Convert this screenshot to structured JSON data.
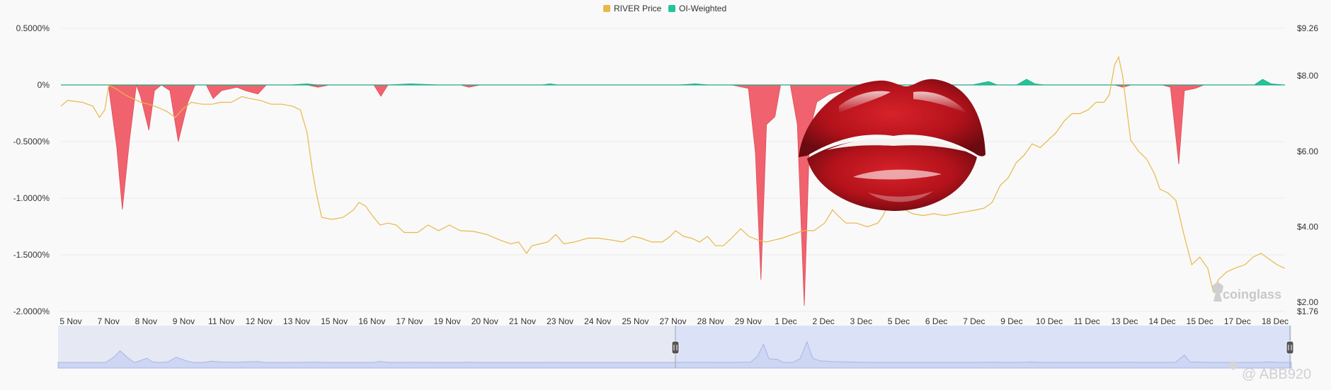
{
  "chart_data": {
    "type": "area",
    "legend": [
      {
        "name": "RIVER Price",
        "color": "#e8b84a"
      },
      {
        "name": "OI-Weighted",
        "color": "#22c59a"
      }
    ],
    "legend_position": "top-center",
    "negative_color": "#f0636e",
    "grid": true,
    "y_left": {
      "ticks": [
        0.5,
        0,
        -0.5,
        -1.0,
        -1.5,
        -2.0
      ],
      "tick_labels": [
        "0.5000%",
        "0%",
        "-0.5000%",
        "-1.0000%",
        "-1.5000%",
        "-2.0000%"
      ],
      "range": [
        -2.0,
        0.5
      ]
    },
    "y_right": {
      "ticks": [
        9.26,
        8.0,
        6.0,
        4.0,
        2.0,
        1.76
      ],
      "tick_labels": [
        "$9.26",
        "$8.00",
        "$6.00",
        "$4.00",
        "$2.00",
        "$1.76"
      ],
      "range": [
        1.76,
        9.26
      ]
    },
    "x_tick_labels": [
      "5 Nov",
      "7 Nov",
      "8 Nov",
      "9 Nov",
      "11 Nov",
      "12 Nov",
      "13 Nov",
      "15 Nov",
      "16 Nov",
      "17 Nov",
      "19 Nov",
      "20 Nov",
      "21 Nov",
      "23 Nov",
      "24 Nov",
      "25 Nov",
      "27 Nov",
      "28 Nov",
      "29 Nov",
      "1 Dec",
      "2 Dec",
      "3 Dec",
      "5 Dec",
      "6 Dec",
      "7 Dec",
      "9 Dec",
      "10 Dec",
      "11 Dec",
      "13 Dec",
      "14 Dec",
      "15 Dec",
      "17 Dec",
      "18 Dec"
    ],
    "x_range_days": [
      0,
      43.8
    ],
    "series": [
      {
        "name": "OI-Weighted",
        "axis": "left",
        "points": [
          [
            0,
            0
          ],
          [
            1.7,
            0
          ],
          [
            2.0,
            -0.55
          ],
          [
            2.2,
            -1.1
          ],
          [
            2.45,
            -0.5
          ],
          [
            2.7,
            0
          ],
          [
            2.85,
            -0.1
          ],
          [
            3.15,
            -0.4
          ],
          [
            3.35,
            -0.05
          ],
          [
            3.6,
            0
          ],
          [
            3.9,
            -0.05
          ],
          [
            4.2,
            -0.5
          ],
          [
            4.55,
            -0.15
          ],
          [
            4.8,
            0
          ],
          [
            5.2,
            0
          ],
          [
            5.45,
            -0.12
          ],
          [
            5.75,
            -0.05
          ],
          [
            6.3,
            -0.02
          ],
          [
            6.6,
            -0.05
          ],
          [
            7.05,
            -0.08
          ],
          [
            7.35,
            0
          ],
          [
            8.2,
            0
          ],
          [
            8.8,
            0.01
          ],
          [
            9.2,
            -0.02
          ],
          [
            9.6,
            0
          ],
          [
            11.2,
            0
          ],
          [
            11.45,
            -0.1
          ],
          [
            11.7,
            0
          ],
          [
            12.5,
            0.01
          ],
          [
            13.6,
            0
          ],
          [
            14.3,
            0
          ],
          [
            14.6,
            -0.02
          ],
          [
            15.0,
            0
          ],
          [
            17.2,
            0
          ],
          [
            17.5,
            0.01
          ],
          [
            17.8,
            0
          ],
          [
            20.0,
            0
          ],
          [
            21.5,
            0
          ],
          [
            22.1,
            0
          ],
          [
            22.7,
            0.01
          ],
          [
            23.2,
            0
          ],
          [
            24.0,
            0
          ],
          [
            24.6,
            -0.03
          ],
          [
            24.85,
            -0.6
          ],
          [
            25.05,
            -1.72
          ],
          [
            25.25,
            -0.35
          ],
          [
            25.55,
            -0.28
          ],
          [
            25.75,
            0
          ],
          [
            26.1,
            0
          ],
          [
            26.35,
            -0.35
          ],
          [
            26.6,
            -1.95
          ],
          [
            26.8,
            -0.4
          ],
          [
            27.05,
            -0.15
          ],
          [
            27.5,
            -0.08
          ],
          [
            28.5,
            -0.02
          ],
          [
            29.0,
            0
          ],
          [
            32.6,
            0
          ],
          [
            33.2,
            0.03
          ],
          [
            33.5,
            0
          ],
          [
            34.2,
            0
          ],
          [
            34.55,
            0.05
          ],
          [
            34.85,
            0.01
          ],
          [
            35.2,
            0
          ],
          [
            37.7,
            0
          ],
          [
            38.0,
            -0.02
          ],
          [
            38.3,
            0
          ],
          [
            39.4,
            0
          ],
          [
            39.7,
            -0.02
          ],
          [
            40.0,
            -0.7
          ],
          [
            40.2,
            -0.05
          ],
          [
            40.6,
            -0.03
          ],
          [
            40.9,
            0
          ],
          [
            41.0,
            0
          ],
          [
            42.7,
            0
          ],
          [
            43.0,
            0.05
          ],
          [
            43.3,
            0.01
          ],
          [
            43.8,
            0
          ]
        ]
      },
      {
        "name": "RIVER Price",
        "axis": "right",
        "points": [
          [
            0,
            7.2
          ],
          [
            0.25,
            7.35
          ],
          [
            0.8,
            7.3
          ],
          [
            1.2,
            7.2
          ],
          [
            1.45,
            6.9
          ],
          [
            1.65,
            7.1
          ],
          [
            1.8,
            7.75
          ],
          [
            2.1,
            7.65
          ],
          [
            2.4,
            7.5
          ],
          [
            2.7,
            7.4
          ],
          [
            3.0,
            7.3
          ],
          [
            3.3,
            7.25
          ],
          [
            3.7,
            7.15
          ],
          [
            4.0,
            7.05
          ],
          [
            4.3,
            6.9
          ],
          [
            4.55,
            7.1
          ],
          [
            4.9,
            7.3
          ],
          [
            5.3,
            7.25
          ],
          [
            5.7,
            7.25
          ],
          [
            6.0,
            7.3
          ],
          [
            6.4,
            7.3
          ],
          [
            6.8,
            7.45
          ],
          [
            7.1,
            7.4
          ],
          [
            7.5,
            7.35
          ],
          [
            7.9,
            7.25
          ],
          [
            8.3,
            7.25
          ],
          [
            8.7,
            7.2
          ],
          [
            9.0,
            7.1
          ],
          [
            9.25,
            6.5
          ],
          [
            9.45,
            5.5
          ],
          [
            9.6,
            4.9
          ],
          [
            9.8,
            4.25
          ],
          [
            10.2,
            4.2
          ],
          [
            10.6,
            4.25
          ],
          [
            11.0,
            4.45
          ],
          [
            11.2,
            4.65
          ],
          [
            11.45,
            4.55
          ],
          [
            11.7,
            4.3
          ],
          [
            12.0,
            4.05
          ],
          [
            12.3,
            4.1
          ],
          [
            12.6,
            4.05
          ],
          [
            12.9,
            3.85
          ],
          [
            13.4,
            3.85
          ],
          [
            13.8,
            4.05
          ],
          [
            14.2,
            3.9
          ],
          [
            14.6,
            4.05
          ],
          [
            15.0,
            3.9
          ],
          [
            15.5,
            3.88
          ],
          [
            16.0,
            3.8
          ],
          [
            16.5,
            3.65
          ],
          [
            16.9,
            3.55
          ],
          [
            17.2,
            3.6
          ],
          [
            17.5,
            3.3
          ],
          [
            17.7,
            3.5
          ],
          [
            18.0,
            3.55
          ],
          [
            18.3,
            3.6
          ],
          [
            18.6,
            3.8
          ],
          [
            18.9,
            3.55
          ],
          [
            19.3,
            3.6
          ],
          [
            19.8,
            3.7
          ],
          [
            20.2,
            3.7
          ],
          [
            20.7,
            3.65
          ],
          [
            21.1,
            3.6
          ],
          [
            21.5,
            3.75
          ],
          [
            21.8,
            3.7
          ],
          [
            22.2,
            3.6
          ],
          [
            22.6,
            3.6
          ],
          [
            22.9,
            3.75
          ],
          [
            23.1,
            3.9
          ],
          [
            23.4,
            3.75
          ],
          [
            23.7,
            3.7
          ],
          [
            24.0,
            3.6
          ],
          [
            24.3,
            3.75
          ],
          [
            24.6,
            3.5
          ],
          [
            24.9,
            3.5
          ],
          [
            25.2,
            3.7
          ],
          [
            25.55,
            3.95
          ],
          [
            25.85,
            3.75
          ],
          [
            26.2,
            3.65
          ],
          [
            26.5,
            3.6
          ],
          [
            26.8,
            3.65
          ],
          [
            27.1,
            3.7
          ],
          [
            27.5,
            3.8
          ],
          [
            27.9,
            3.9
          ],
          [
            28.3,
            3.9
          ],
          [
            28.7,
            4.1
          ],
          [
            29.0,
            4.45
          ],
          [
            29.2,
            4.3
          ],
          [
            29.5,
            4.1
          ],
          [
            29.9,
            4.1
          ],
          [
            30.3,
            4.0
          ],
          [
            30.7,
            4.1
          ],
          [
            30.9,
            4.3
          ],
          [
            31.1,
            4.6
          ],
          [
            31.3,
            4.7
          ],
          [
            31.6,
            4.5
          ],
          [
            32.0,
            4.35
          ],
          [
            32.4,
            4.3
          ],
          [
            32.8,
            4.35
          ],
          [
            33.2,
            4.3
          ],
          [
            33.6,
            4.35
          ],
          [
            34.0,
            4.4
          ],
          [
            34.4,
            4.45
          ],
          [
            34.7,
            4.5
          ],
          [
            35.0,
            4.65
          ],
          [
            35.3,
            5.1
          ],
          [
            35.6,
            5.3
          ],
          [
            35.9,
            5.7
          ],
          [
            36.2,
            5.9
          ],
          [
            36.5,
            6.2
          ],
          [
            36.8,
            6.1
          ],
          [
            37.1,
            6.3
          ],
          [
            37.4,
            6.5
          ],
          [
            37.7,
            6.8
          ],
          [
            38.0,
            7.0
          ],
          [
            38.3,
            7.0
          ],
          [
            38.6,
            7.1
          ],
          [
            38.9,
            7.3
          ],
          [
            39.2,
            7.3
          ],
          [
            39.4,
            7.5
          ],
          [
            39.6,
            8.3
          ],
          [
            39.75,
            8.5
          ],
          [
            39.9,
            8.0
          ],
          [
            40.2,
            6.3
          ],
          [
            40.5,
            6.0
          ],
          [
            40.8,
            5.8
          ],
          [
            41.1,
            5.4
          ],
          [
            41.3,
            5.0
          ],
          [
            41.6,
            4.9
          ],
          [
            41.9,
            4.7
          ],
          [
            42.2,
            3.8
          ],
          [
            42.5,
            3.0
          ],
          [
            42.8,
            3.2
          ],
          [
            43.1,
            2.9
          ],
          [
            43.3,
            2.3
          ],
          [
            43.5,
            2.6
          ],
          [
            43.8,
            2.8
          ],
          [
            44.1,
            2.9
          ],
          [
            44.5,
            3.0
          ],
          [
            44.8,
            3.2
          ],
          [
            45.1,
            3.3
          ],
          [
            45.4,
            3.15
          ],
          [
            45.7,
            3.0
          ],
          [
            46.0,
            2.9
          ]
        ]
      }
    ],
    "watermark": "coinglass"
  },
  "footer": {
    "credit": "@ ABB920"
  },
  "navigator": {
    "series": "OI-Weighted overview"
  }
}
